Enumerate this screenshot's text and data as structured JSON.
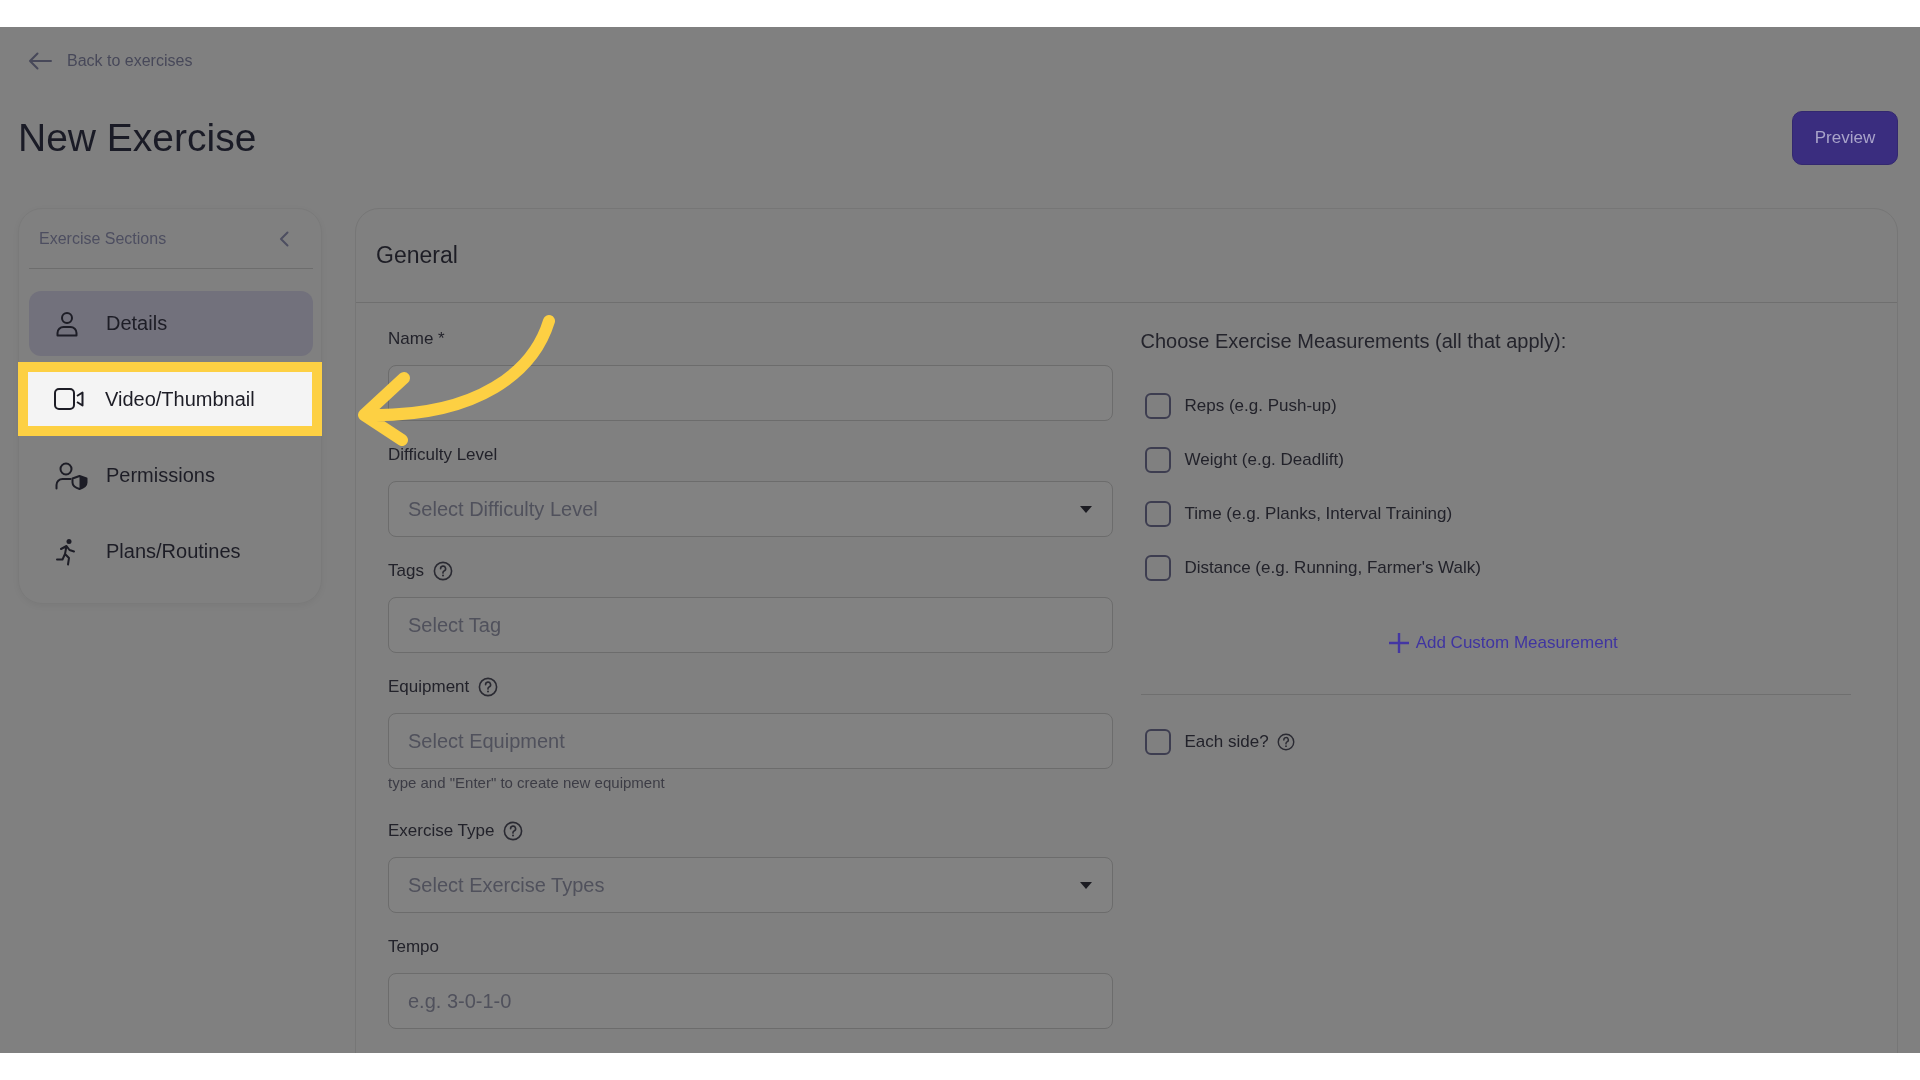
{
  "back_link": {
    "label": "Back to exercises"
  },
  "title": "New Exercise",
  "preview_button": {
    "label": "Preview"
  },
  "sidebar": {
    "title": "Exercise Sections",
    "items": [
      {
        "label": "Details",
        "selected": true,
        "highlighted": false
      },
      {
        "label": "Video/Thumbnail",
        "selected": false,
        "highlighted": true
      },
      {
        "label": "Permissions",
        "selected": false,
        "highlighted": false
      },
      {
        "label": "Plans/Routines",
        "selected": false,
        "highlighted": false
      }
    ]
  },
  "general": {
    "title": "General",
    "fields": [
      {
        "kind": "text",
        "label": "Name *",
        "help": false
      },
      {
        "kind": "select",
        "label": "Difficulty Level",
        "help": false,
        "placeholder": "Select Difficulty Level"
      },
      {
        "kind": "text",
        "label": "Tags",
        "help": true,
        "placeholder": "Select Tag"
      },
      {
        "kind": "text",
        "label": "Equipment",
        "help": true,
        "placeholder": "Select Equipment",
        "hint": "type and \"Enter\" to create new equipment"
      },
      {
        "kind": "select",
        "label": "Exercise Type",
        "help": true,
        "placeholder": "Select Exercise Types"
      },
      {
        "kind": "text",
        "label": "Tempo",
        "help": false,
        "placeholder": "e.g. 3-0-1-0"
      }
    ],
    "measurements": {
      "title": "Choose Exercise Measurements (all that apply):",
      "options": [
        {
          "label": "Reps (e.g. Push-up)",
          "checked": false
        },
        {
          "label": "Weight (e.g. Deadlift)",
          "checked": false
        },
        {
          "label": "Time (e.g. Planks, Interval Training)",
          "checked": false
        },
        {
          "label": "Distance (e.g. Running, Farmer's Walk)",
          "checked": false
        }
      ],
      "add_button": {
        "label": "Add Custom Measurement"
      }
    },
    "each_side": {
      "label": "Each side?",
      "checked": false,
      "help": true
    }
  }
}
